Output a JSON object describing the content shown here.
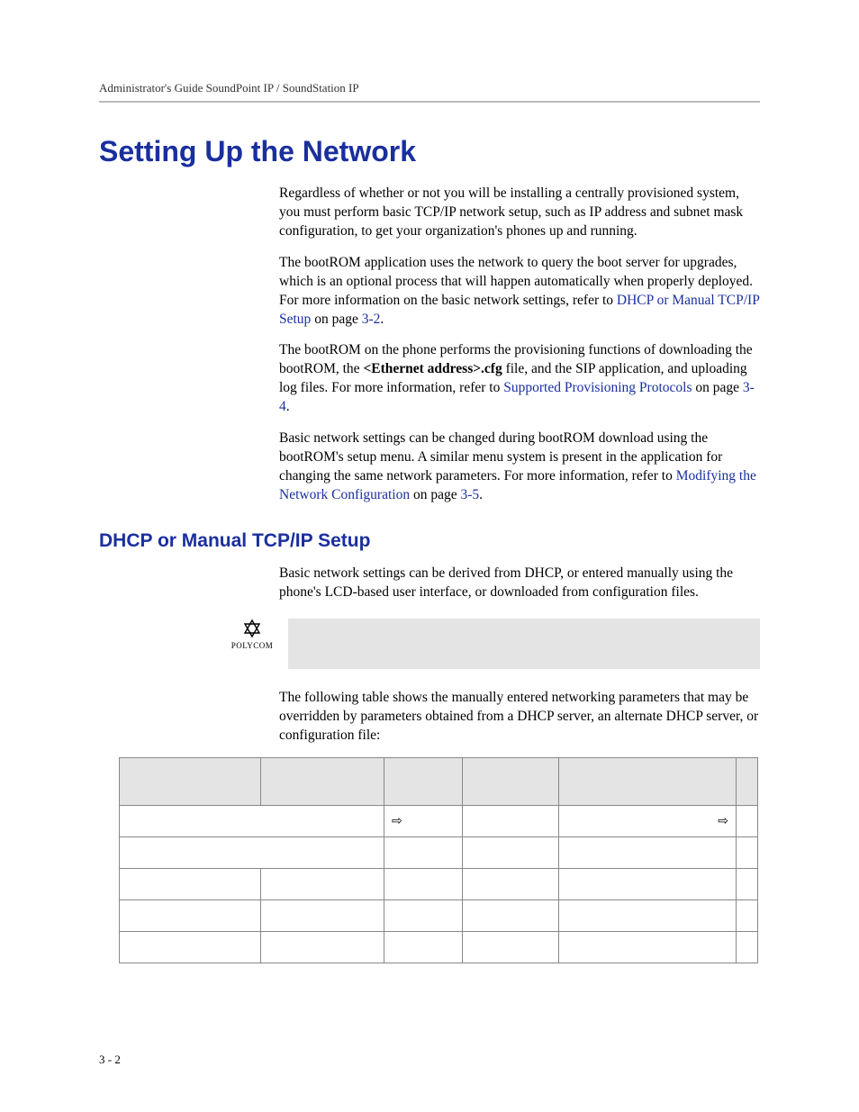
{
  "header": "Administrator's Guide SoundPoint IP / SoundStation IP",
  "title": "Setting Up the Network",
  "para1": "Regardless of whether or not you will be installing a centrally provisioned system, you must perform basic TCP/IP network setup, such as IP address and subnet mask configuration, to get your organization's phones up and running.",
  "para2a": "The bootROM application uses the network to query the boot server for upgrades, which is an optional process that will happen automatically when properly deployed. For more information on the basic network settings, refer to ",
  "para2_link": "DHCP or Manual TCP/IP Setup",
  "para2b": " on page ",
  "para2_page": "3-2",
  "para2c": ".",
  "para3a": "The bootROM on the phone performs the provisioning functions of downloading the bootROM, the ",
  "para3_bold": "<Ethernet address>.cfg",
  "para3b": " file, and the SIP application, and uploading log files. For more information, refer to ",
  "para3_link": "Supported Provisioning Protocols",
  "para3c": " on page ",
  "para3_page": "3-4",
  "para3d": ".",
  "para4a": "Basic network settings can be changed during bootROM download using the bootROM's setup menu. A similar menu system is present in the application for changing the same network parameters. For more information, refer to ",
  "para4_link": "Modifying the Network Configuration",
  "para4b": " on page ",
  "para4_page": "3-5",
  "para4c": ".",
  "subsection": "DHCP or Manual TCP/IP Setup",
  "para5": "Basic network settings can be derived from DHCP, or entered manually using the phone's LCD-based user interface, or downloaded from configuration files.",
  "brand": "POLYCOM",
  "para6": "The following table shows the manually entered networking parameters that may be overridden by parameters obtained from a DHCP server, an alternate DHCP server, or configuration file:",
  "arrow": "⇨",
  "page_num": "3 - 2"
}
